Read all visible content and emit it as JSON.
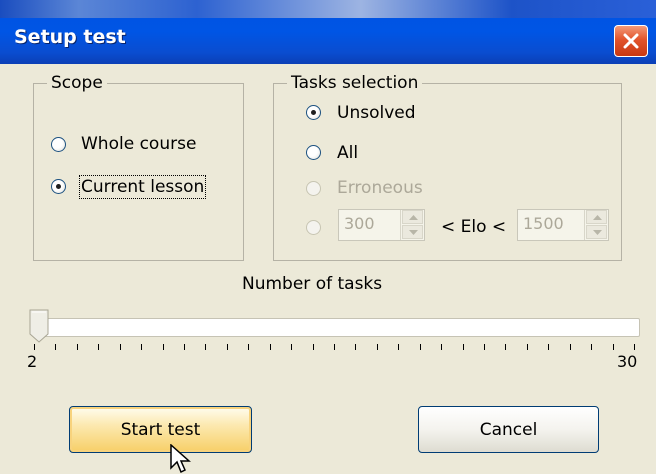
{
  "window": {
    "title": "Setup test",
    "close_icon": "close-icon"
  },
  "scope": {
    "title": "Scope",
    "options": [
      {
        "label": "Whole course",
        "selected": false
      },
      {
        "label": "Current lesson",
        "selected": true
      }
    ]
  },
  "tasks": {
    "title": "Tasks selection",
    "options": [
      {
        "label": "Unsolved",
        "selected": true,
        "enabled": true
      },
      {
        "label": "All",
        "selected": false,
        "enabled": true
      },
      {
        "label": "Erroneous",
        "selected": false,
        "enabled": false
      },
      {
        "label": "",
        "selected": false,
        "enabled": false
      }
    ],
    "elo_min": "300",
    "elo_label": "< Elo <",
    "elo_max": "1500"
  },
  "slider": {
    "label": "Number of tasks",
    "min_label": "2",
    "max_label": "30",
    "value": 2
  },
  "buttons": {
    "start": "Start test",
    "cancel": "Cancel"
  },
  "colors": {
    "titlebar": "#0055e5",
    "close": "#e2542c",
    "start_button": "#fce9b0",
    "dialog_bg": "#ece9d8"
  }
}
